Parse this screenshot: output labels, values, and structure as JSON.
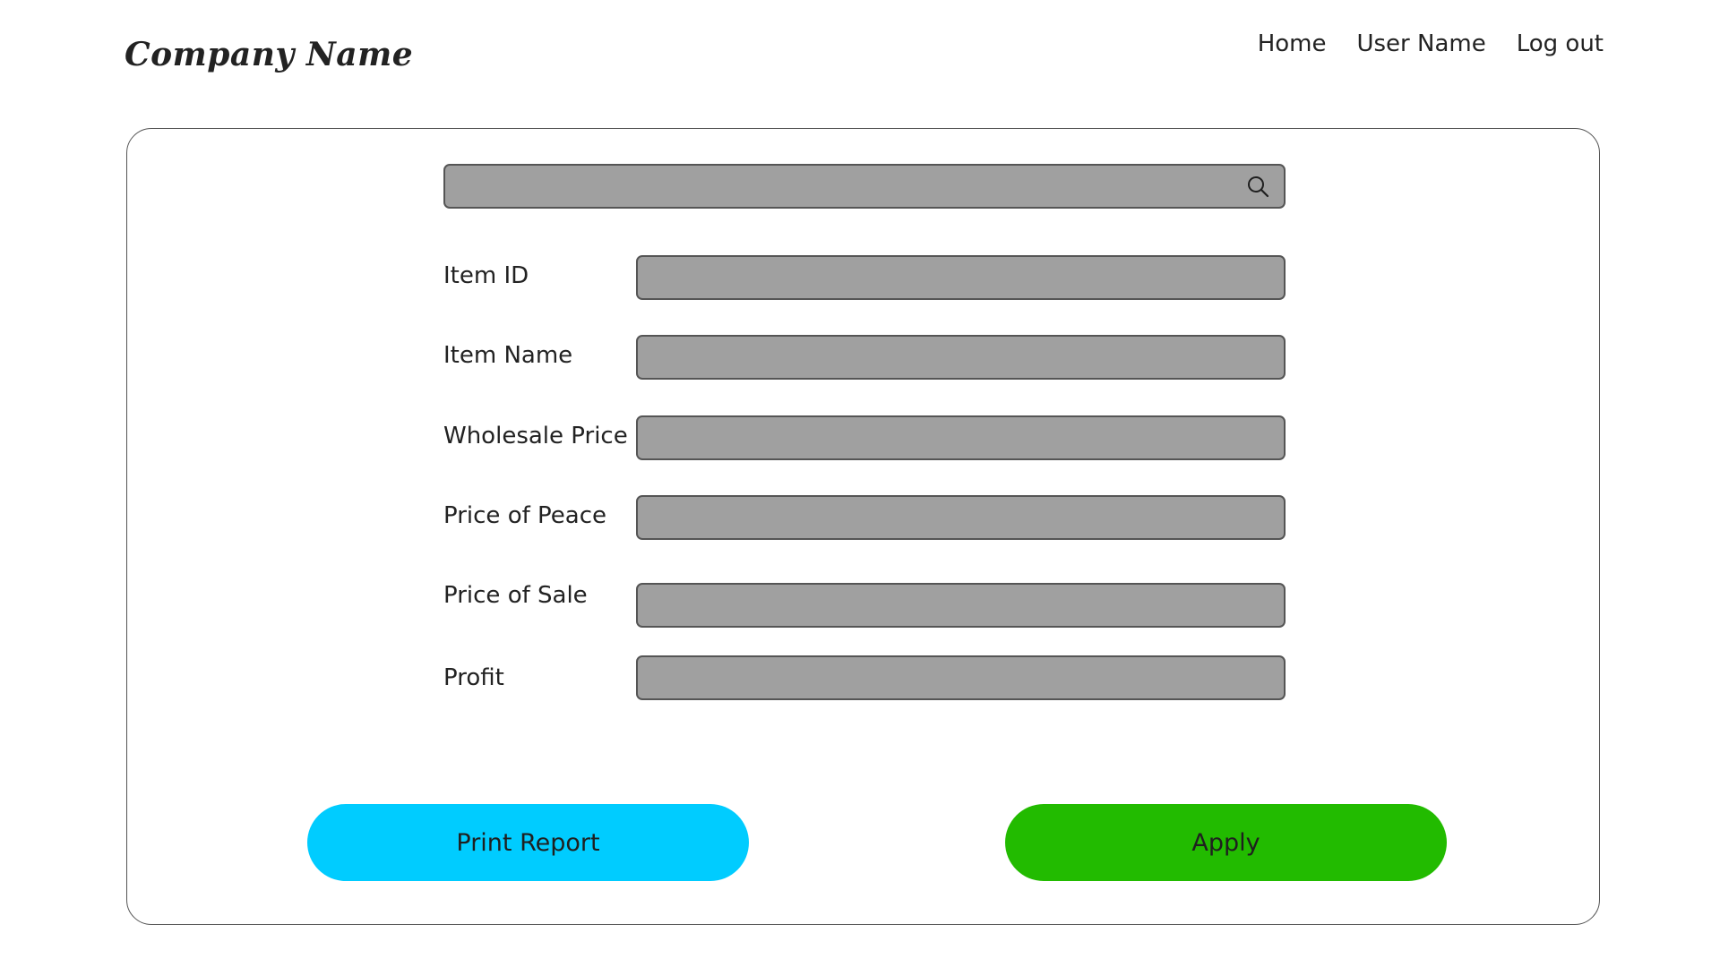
{
  "header": {
    "company_name": "Company Name",
    "nav": [
      "Home",
      "User Name",
      "Log out"
    ]
  },
  "search": {
    "value": "",
    "placeholder": "",
    "icon": "search-icon"
  },
  "form": {
    "fields": [
      {
        "label": "Item ID",
        "value": ""
      },
      {
        "label": "Item Name",
        "value": ""
      },
      {
        "label": "Wholesale Price",
        "value": ""
      },
      {
        "label": "Price of Peace",
        "value": ""
      },
      {
        "label": "Price of Sale",
        "value": ""
      },
      {
        "label": "Profit",
        "value": ""
      }
    ]
  },
  "actions": {
    "print_label": "Print Report",
    "apply_label": "Apply"
  },
  "colors": {
    "field_fill": "#a0a0a0",
    "print_button": "#00ccff",
    "apply_button": "#22bb00"
  }
}
